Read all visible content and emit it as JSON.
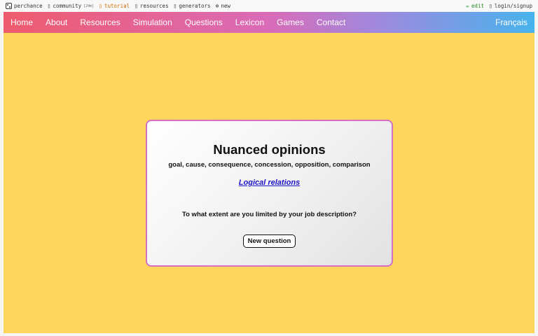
{
  "topbar": {
    "left": [
      {
        "icon": "dice-icon",
        "label": "perchance"
      },
      {
        "icon": "community-icon",
        "label": "community",
        "badge": "[24m]"
      },
      {
        "icon": "tutorial-icon",
        "label": "tutorial"
      },
      {
        "icon": "resources-icon",
        "label": "resources"
      },
      {
        "icon": "generators-icon",
        "label": "generators"
      },
      {
        "icon": "plus-circle-icon",
        "label": "new"
      }
    ],
    "right": [
      {
        "icon": "pencil-icon",
        "label": "edit"
      },
      {
        "icon": "user-icon",
        "label": "login/signup"
      }
    ]
  },
  "nav": {
    "links": [
      "Home",
      "About",
      "Resources",
      "Simulation",
      "Questions",
      "Lexicon",
      "Games",
      "Contact"
    ],
    "lang": "Français"
  },
  "card": {
    "title": "Nuanced opinions",
    "subtitle": "goal, cause, consequence, concession, opposition, comparison",
    "link": "Logical relations",
    "question": "To what extent are you limited by your job description?",
    "button": "New question"
  },
  "colors": {
    "background": "#ffd65c",
    "card_border": "#d56fc2",
    "link": "#1d14c8",
    "nav_gradient_start": "#ef5b6d",
    "nav_gradient_end": "#47b3ec"
  }
}
